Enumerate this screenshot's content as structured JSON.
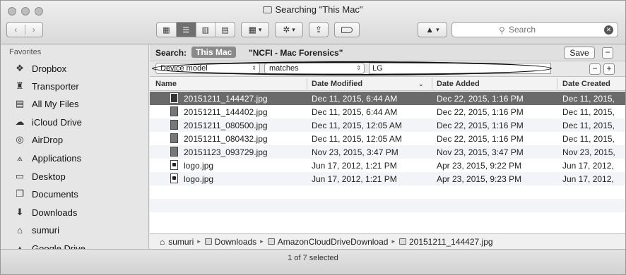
{
  "window": {
    "title": "Searching \"This Mac\""
  },
  "toolbar": {
    "back_icon": "chevron-left",
    "forward_icon": "chevron-right",
    "view_icons": [
      "icon-view",
      "list-view",
      "column-view",
      "cover-flow-view"
    ],
    "arrange_icon": "arrange-grid",
    "action_icon": "gear",
    "share_icon": "share",
    "tags_icon": "tag",
    "font_icon": "text-size",
    "search_placeholder": "Search"
  },
  "sidebar": {
    "heading": "Favorites",
    "items": [
      {
        "label": "Dropbox",
        "icon": "dropbox-icon"
      },
      {
        "label": "Transporter",
        "icon": "transporter-icon"
      },
      {
        "label": "All My Files",
        "icon": "all-files-icon"
      },
      {
        "label": "iCloud Drive",
        "icon": "cloud-icon"
      },
      {
        "label": "AirDrop",
        "icon": "airdrop-icon"
      },
      {
        "label": "Applications",
        "icon": "applications-icon"
      },
      {
        "label": "Desktop",
        "icon": "desktop-icon"
      },
      {
        "label": "Documents",
        "icon": "documents-icon"
      },
      {
        "label": "Downloads",
        "icon": "downloads-icon"
      },
      {
        "label": "sumuri",
        "icon": "home-icon"
      },
      {
        "label": "Google Drive",
        "icon": "google-drive-icon"
      }
    ]
  },
  "search": {
    "label": "Search:",
    "scope_active": "This Mac",
    "scope_other": "\"NCFI - Mac Forensics\"",
    "save_label": "Save",
    "minus_label": "−",
    "plus_label": "+",
    "criteria": {
      "attribute": "Device model",
      "operator": "matches",
      "value": "LG"
    }
  },
  "list": {
    "columns": [
      "Name",
      "Date Modified",
      "Date Added",
      "Date Created"
    ],
    "rows": [
      {
        "name": "20151211_144427.jpg",
        "modified": "Dec 11, 2015, 6:44 AM",
        "added": "Dec 22, 2015, 1:16 PM",
        "created": "Dec 11, 2015,",
        "selected": true
      },
      {
        "name": "20151211_144402.jpg",
        "modified": "Dec 11, 2015, 6:44 AM",
        "added": "Dec 22, 2015, 1:16 PM",
        "created": "Dec 11, 2015,",
        "selected": false
      },
      {
        "name": "20151211_080500.jpg",
        "modified": "Dec 11, 2015, 12:05 AM",
        "added": "Dec 22, 2015, 1:16 PM",
        "created": "Dec 11, 2015,",
        "selected": false
      },
      {
        "name": "20151211_080432.jpg",
        "modified": "Dec 11, 2015, 12:05 AM",
        "added": "Dec 22, 2015, 1:16 PM",
        "created": "Dec 11, 2015,",
        "selected": false
      },
      {
        "name": "20151123_093729.jpg",
        "modified": "Nov 23, 2015, 3:47 PM",
        "added": "Nov 23, 2015, 3:47 PM",
        "created": "Nov 23, 2015,",
        "selected": false
      },
      {
        "name": "logo.jpg",
        "modified": "Jun 17, 2012, 1:21 PM",
        "added": "Apr 23, 2015, 9:22 PM",
        "created": "Jun 17, 2012,",
        "selected": false
      },
      {
        "name": "logo.jpg",
        "modified": "Jun 17, 2012, 1:21 PM",
        "added": "Apr 23, 2015, 9:23 PM",
        "created": "Jun 17, 2012,",
        "selected": false
      }
    ]
  },
  "pathbar": {
    "segments": [
      "sumuri",
      "Downloads",
      "AmazonCloudDriveDownload",
      "20151211_144427.jpg"
    ]
  },
  "status": {
    "text": "1 of 7 selected"
  }
}
